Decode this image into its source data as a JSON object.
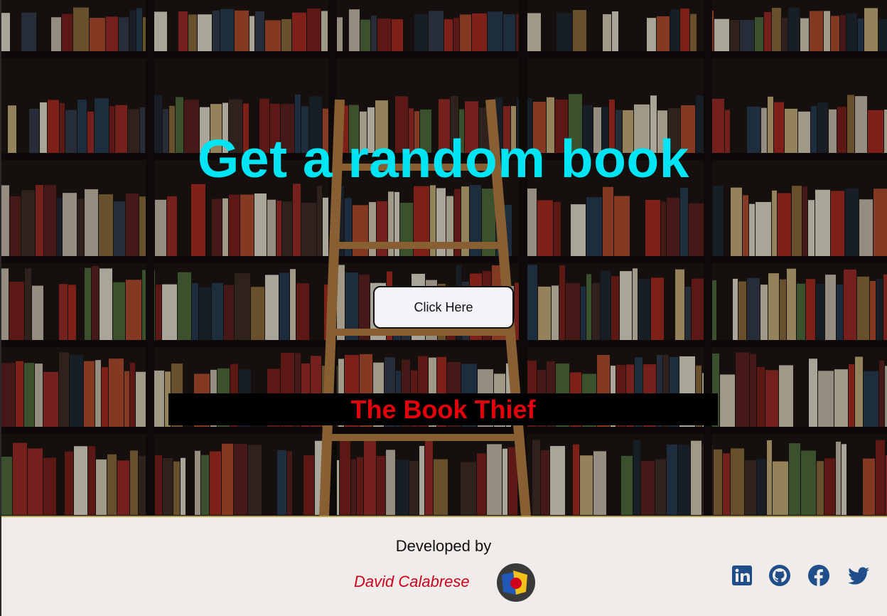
{
  "hero": {
    "headline": "Get a random book",
    "button_label": "Click Here"
  },
  "result": {
    "book_title": "The Book Thief"
  },
  "footer": {
    "developed_by": "Developed by",
    "author_name": "David Calabrese",
    "social": [
      "linkedin-icon",
      "github-icon",
      "facebook-icon",
      "twitter-icon"
    ]
  },
  "colors": {
    "headline": "#00e5f4",
    "book_title": "#e3000b",
    "author": "#d0021b",
    "social_icons": "#1f4e8a"
  }
}
